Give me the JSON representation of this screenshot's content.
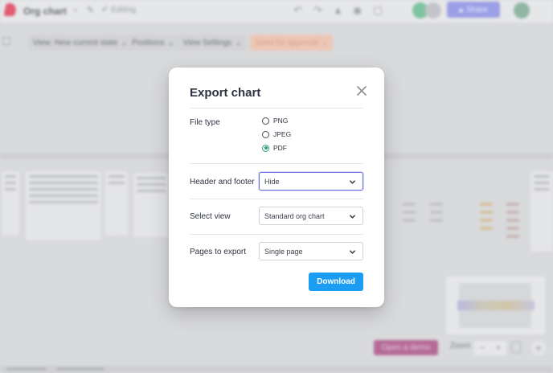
{
  "app": {
    "doc_title": "Org chart",
    "edit_label": "Editing",
    "share_label": "Share",
    "toolbar": [
      {
        "label": "View: New current state"
      },
      {
        "label": "Positions"
      },
      {
        "label": "View Settings"
      },
      {
        "label": "Send for approval"
      }
    ],
    "open_demo_label": "Open a demo",
    "zoom_label": "Zoom",
    "zoom_minus": "−",
    "zoom_plus": "+",
    "add_label": "+"
  },
  "modal": {
    "title": "Export chart",
    "file_type": {
      "label": "File type",
      "options": [
        {
          "label": "PNG",
          "checked": false
        },
        {
          "label": "JPEG",
          "checked": false
        },
        {
          "label": "PDF",
          "checked": true
        }
      ]
    },
    "header_footer": {
      "label": "Header and footer",
      "value": "Hide"
    },
    "select_view": {
      "label": "Select view",
      "value": "Standard org chart"
    },
    "pages_to_export": {
      "label": "Pages to export",
      "value": "Single page"
    },
    "download_label": "Download"
  },
  "colors": {
    "accent": "#1b9df3",
    "radio_checked": "#2fa176",
    "focus_border": "#6c6ee0"
  }
}
